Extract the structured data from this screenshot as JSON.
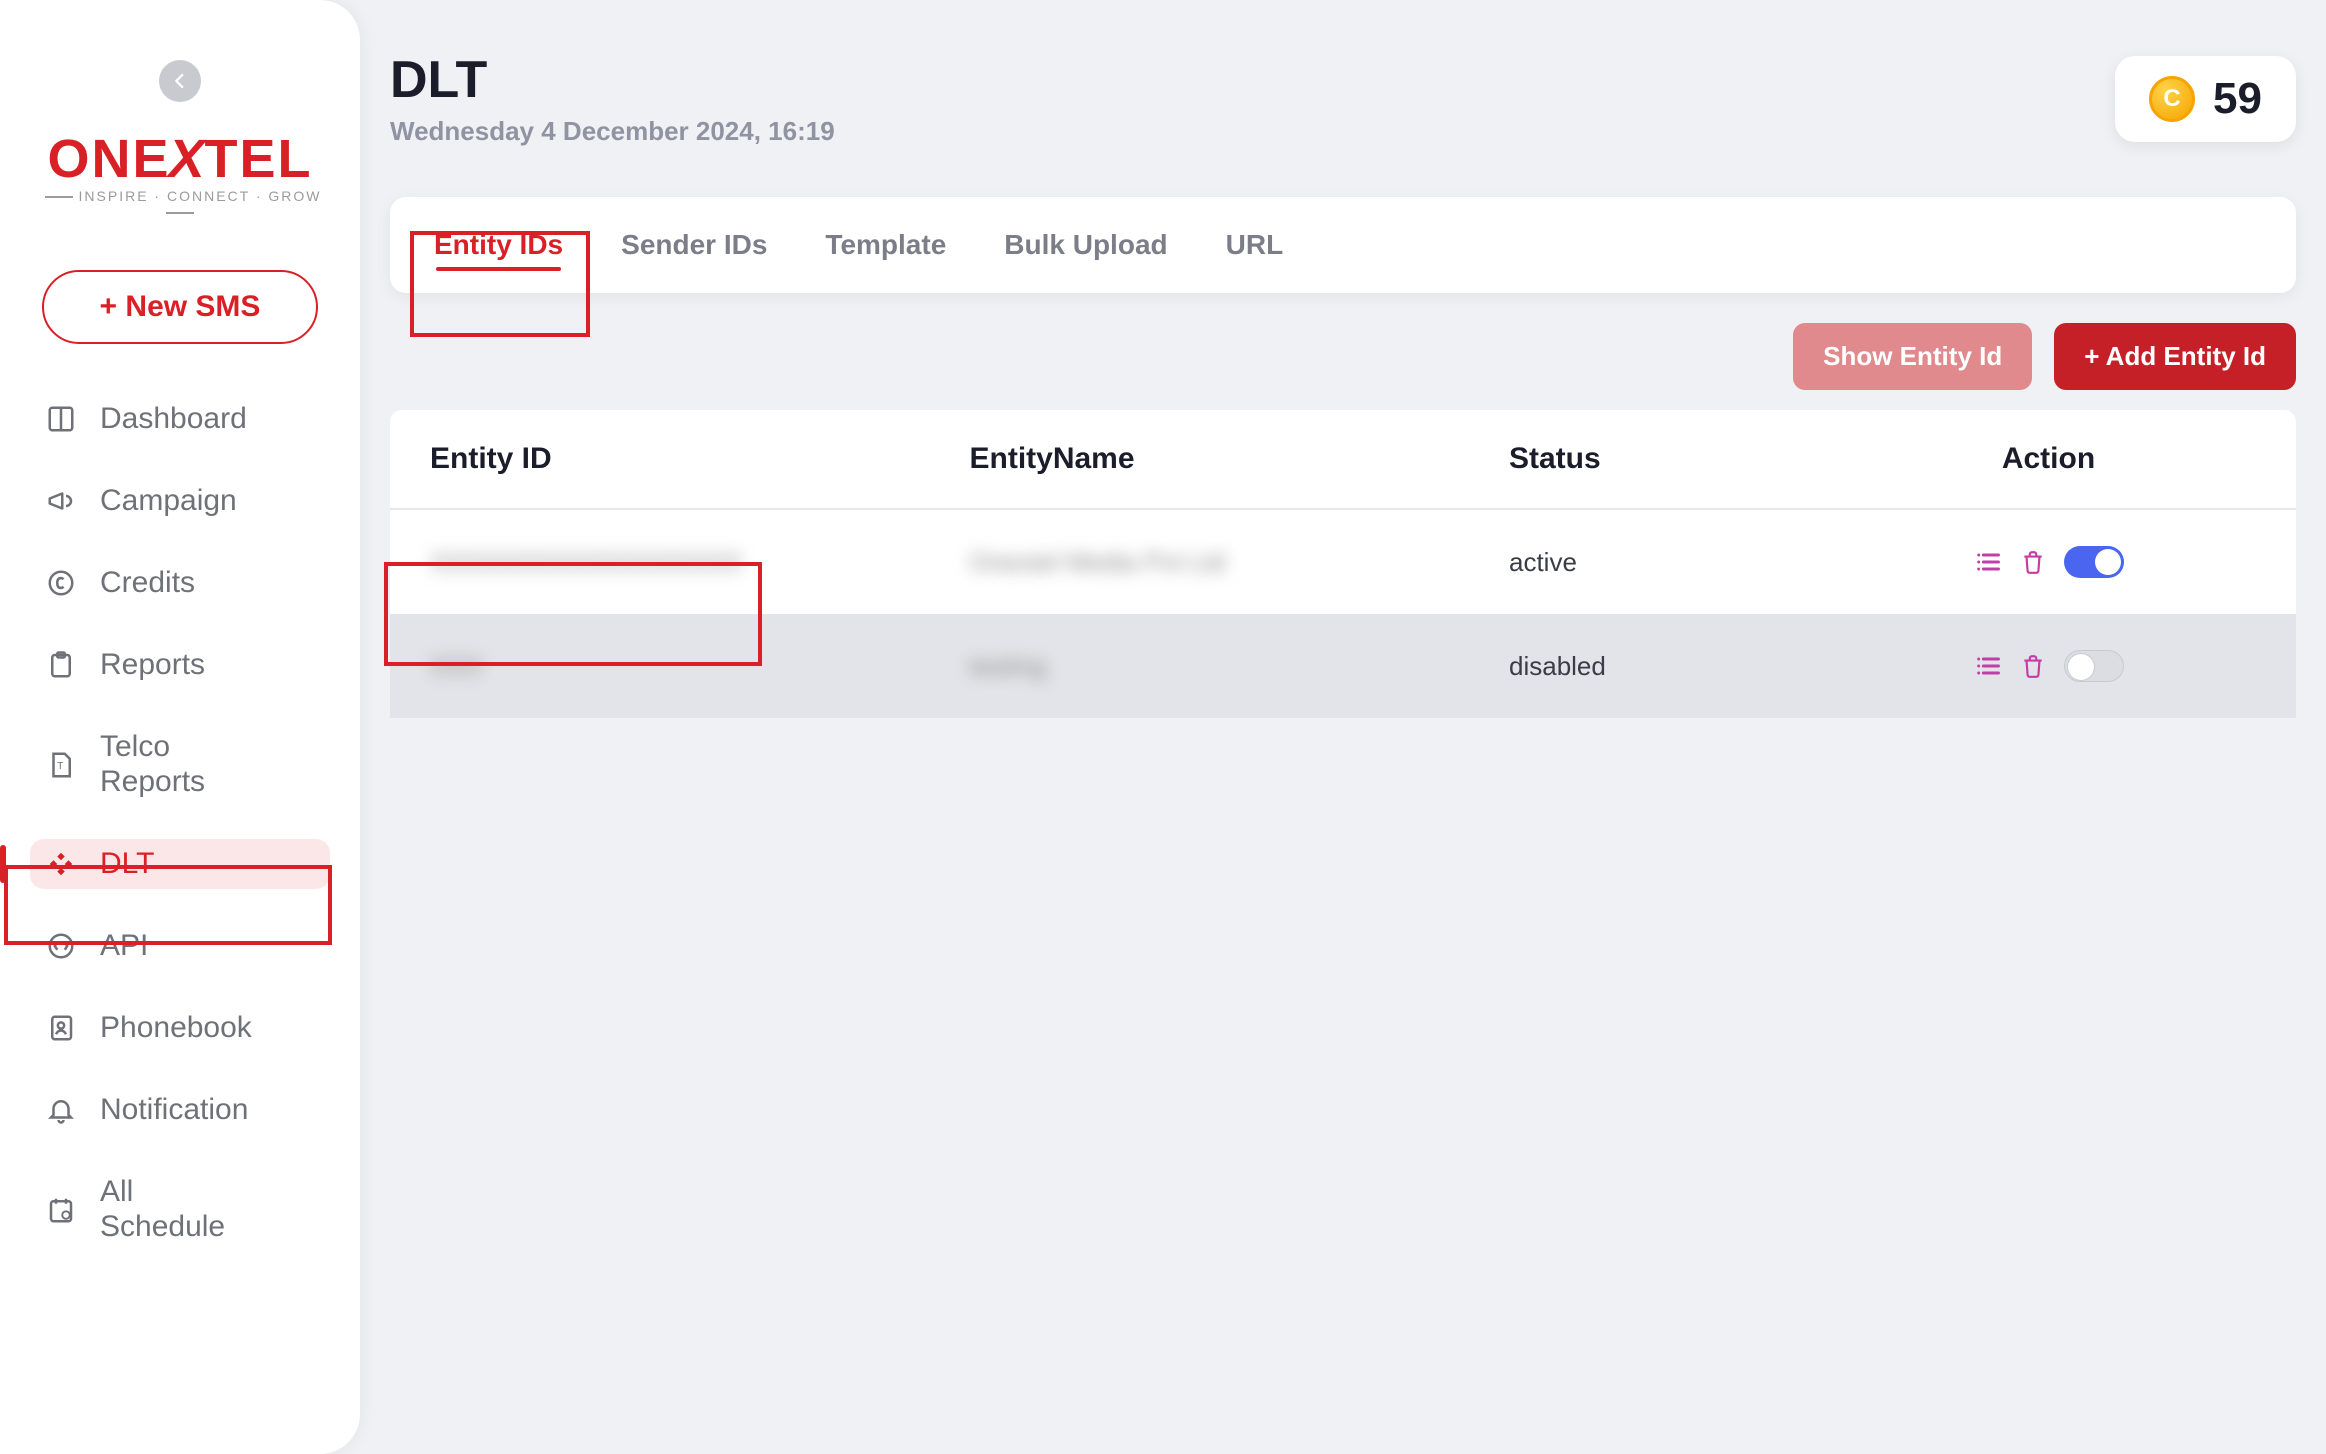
{
  "logo": {
    "brand": "ONEXTEL",
    "tagline": "INSPIRE · CONNECT · GROW"
  },
  "new_sms_label": "+ New SMS",
  "sidebar": {
    "items": [
      {
        "label": "Dashboard",
        "active": false
      },
      {
        "label": "Campaign",
        "active": false
      },
      {
        "label": "Credits",
        "active": false
      },
      {
        "label": "Reports",
        "active": false
      },
      {
        "label": "Telco Reports",
        "active": false
      },
      {
        "label": "DLT",
        "active": true
      },
      {
        "label": "API",
        "active": false
      },
      {
        "label": "Phonebook",
        "active": false
      },
      {
        "label": "Notification",
        "active": false
      },
      {
        "label": "All Schedule",
        "active": false
      }
    ]
  },
  "header": {
    "title": "DLT",
    "subtitle": "Wednesday 4 December 2024, 16:19",
    "credits": "59"
  },
  "tabs": [
    {
      "label": "Entity IDs",
      "active": true
    },
    {
      "label": "Sender IDs",
      "active": false
    },
    {
      "label": "Template",
      "active": false
    },
    {
      "label": "Bulk Upload",
      "active": false
    },
    {
      "label": "URL",
      "active": false
    }
  ],
  "actions": {
    "show_label": "Show Entity Id",
    "add_label": "+ Add Entity Id"
  },
  "table": {
    "columns": [
      "Entity ID",
      "EntityName",
      "Status",
      "Action"
    ],
    "rows": [
      {
        "entity_id": "XXXXXXXXXXXXXXXXXX",
        "entity_name": "Onextel Media Pvt Ltd",
        "status": "active",
        "enabled": true
      },
      {
        "entity_id": "XXX",
        "entity_name": "testing",
        "status": "disabled",
        "enabled": false
      }
    ]
  }
}
